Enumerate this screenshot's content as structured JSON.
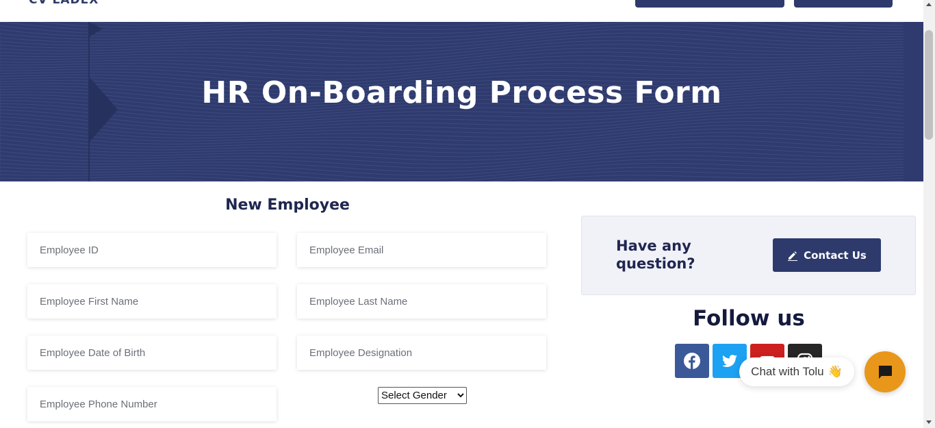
{
  "header": {
    "logo_text": "CV LADEX",
    "nav_button_1": "",
    "nav_button_2": ""
  },
  "hero": {
    "title": "HR On-Boarding Process Form"
  },
  "form": {
    "heading": "New Employee",
    "fields": {
      "employee_id": "Employee ID",
      "employee_email": "Employee Email",
      "first_name": "Employee First Name",
      "last_name": "Employee Last Name",
      "date_of_birth": "Employee Date of Birth",
      "designation": "Employee Designation",
      "phone_number": "Employee Phone Number"
    },
    "gender_select": {
      "selected": "Select Gender"
    }
  },
  "sidebar": {
    "question_text": "Have any question?",
    "contact_button": "Contact Us",
    "follow_title": "Follow us",
    "social_icons": [
      "facebook-icon",
      "twitter-icon",
      "youtube-icon",
      "instagram-icon"
    ]
  },
  "chat": {
    "bubble_text": "Chat with Tolu",
    "bubble_emoji": "👋"
  },
  "colors": {
    "primary": "#2d3a6b",
    "hero_bg": "#2f3b6e",
    "chat_accent": "#e8971a",
    "facebook": "#3b5998",
    "twitter": "#1da1f2",
    "youtube": "#cd201f",
    "instagram": "#262626"
  }
}
